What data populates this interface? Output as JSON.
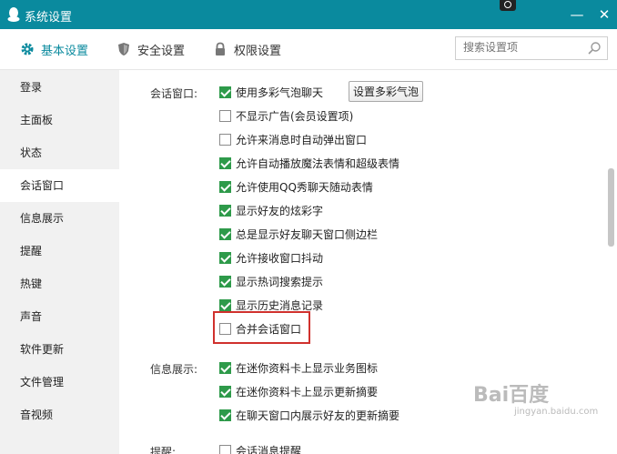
{
  "window": {
    "title": "系统设置",
    "minimize": "—",
    "close": "✕"
  },
  "tabs": [
    {
      "label": "基本设置",
      "icon": "gear-icon"
    },
    {
      "label": "安全设置",
      "icon": "shield-icon"
    },
    {
      "label": "权限设置",
      "icon": "lock-icon"
    }
  ],
  "search": {
    "placeholder": "搜索设置项"
  },
  "sidebar": {
    "items": [
      {
        "label": "登录"
      },
      {
        "label": "主面板"
      },
      {
        "label": "状态"
      },
      {
        "label": "会话窗口"
      },
      {
        "label": "信息展示"
      },
      {
        "label": "提醒"
      },
      {
        "label": "热键"
      },
      {
        "label": "声音"
      },
      {
        "label": "软件更新"
      },
      {
        "label": "文件管理"
      },
      {
        "label": "音视频"
      }
    ],
    "active": "会话窗口"
  },
  "session": {
    "label": "会话窗口:",
    "button": "设置多彩气泡",
    "options": [
      {
        "label": "使用多彩气泡聊天",
        "checked": true
      },
      {
        "label": "不显示广告(会员设置项)",
        "checked": false
      },
      {
        "label": "允许来消息时自动弹出窗口",
        "checked": false
      },
      {
        "label": "允许自动播放魔法表情和超级表情",
        "checked": true
      },
      {
        "label": "允许使用QQ秀聊天随动表情",
        "checked": true
      },
      {
        "label": "显示好友的炫彩字",
        "checked": true
      },
      {
        "label": "总是显示好友聊天窗口侧边栏",
        "checked": true
      },
      {
        "label": "允许接收窗口抖动",
        "checked": true
      },
      {
        "label": "显示热词搜索提示",
        "checked": true
      },
      {
        "label": "显示历史消息记录",
        "checked": true
      },
      {
        "label": "合并会话窗口",
        "checked": false
      }
    ]
  },
  "info": {
    "label": "信息展示:",
    "options": [
      {
        "label": "在迷你资料卡上显示业务图标",
        "checked": true
      },
      {
        "label": "在迷你资料卡上显示更新摘要",
        "checked": true
      },
      {
        "label": "在聊天窗口内展示好友的更新摘要",
        "checked": true
      }
    ]
  },
  "remind": {
    "label": "提醒:",
    "options": [
      {
        "label": "会话消息提醒",
        "checked": false
      }
    ]
  },
  "watermark": {
    "brand": "Bai百度",
    "sub": "jingyan.baidu.com"
  },
  "colors": {
    "titlebar": "#0a8a9e",
    "accent": "#0a8a9e",
    "check": "#2e9a4a",
    "highlight": "#d0312d",
    "sidebar": "#f1f1f1"
  }
}
